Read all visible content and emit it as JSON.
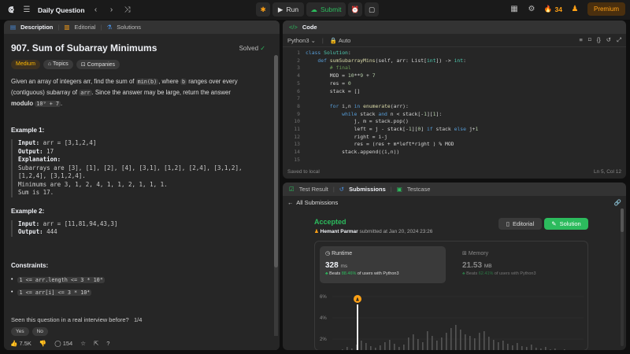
{
  "topbar": {
    "title": "Daily Question",
    "run_label": "Run",
    "submit_label": "Submit",
    "streak": "34",
    "premium_label": "Premium"
  },
  "left_tabs": {
    "description": "Description",
    "editorial": "Editorial",
    "solutions": "Solutions"
  },
  "problem": {
    "title": "907. Sum of Subarray Minimums",
    "status": "Solved",
    "tags": [
      "Medium",
      "Topics",
      "Companies"
    ],
    "desc_1": "Given an array of integers arr, find the sum of ",
    "desc_code_1": "min(b)",
    "desc_2": ", where ",
    "desc_code_2": "b",
    "desc_3": " ranges over every (contiguous) subarray of ",
    "desc_code_3": "arr",
    "desc_4": ". Since the answer may be large, return the answer ",
    "desc_bold": "modulo",
    "desc_code_4": "10⁹ + 7",
    "desc_5": ".",
    "example1_title": "Example 1:",
    "example1_input_label": "Input:",
    "example1_input": " arr = [3,1,2,4]",
    "example1_output_label": "Output:",
    "example1_output": " 17",
    "example1_expl_label": "Explanation:",
    "example1_expl": "Subarrays are [3], [1], [2], [4], [3,1], [1,2], [2,4], [3,1,2],\n[1,2,4], [3,1,2,4].\nMinimums are 3, 1, 2, 4, 1, 1, 2, 1, 1, 1.\nSum is 17.",
    "example2_title": "Example 2:",
    "example2_input_label": "Input:",
    "example2_input": " arr = [11,81,94,43,3]",
    "example2_output_label": "Output:",
    "example2_output": " 444",
    "constraints_title": "Constraints:",
    "constraint_1": "1 <= arr.length <= 3 * 10⁴",
    "constraint_2": "1 <= arr[i] <= 3 * 10⁴",
    "interview_q": "Seen this question in a real interview before?",
    "interview_count": "1/4",
    "yes": "Yes",
    "no": "No",
    "likes": "7.5K",
    "comments": "154"
  },
  "code_panel": {
    "tab": "Code",
    "language": "Python3",
    "mode": "Auto",
    "saved": "Saved to local",
    "cursor": "Ln 5, Col 12",
    "line_numbers": "1\n2\n3\n4\n5\n6\n7\n8\n9\n10\n11\n12\n13\n14\n15"
  },
  "submissions": {
    "tabs": [
      "Test Result",
      "Submissions",
      "Testcase"
    ],
    "all_label": "All Submissions",
    "result": "Accepted",
    "author": "Hemant Parmar",
    "submitted": " submitted at Jan 20, 2024 23:26",
    "editorial_btn": "Editorial",
    "solution_btn": "Solution",
    "runtime_label": "Runtime",
    "runtime_value": "328",
    "runtime_unit": "ms",
    "runtime_beats_pre": "Beats ",
    "runtime_beats": "88.46%",
    "runtime_beats_post": " of users with Python3",
    "memory_label": "Memory",
    "memory_value": "21.53",
    "memory_unit": "MB",
    "memory_beats_pre": "Beats ",
    "memory_beats": "62.41%",
    "memory_beats_post": " of users with Python3",
    "y_ticks": [
      "6%",
      "4%",
      "2%"
    ]
  },
  "colors": {
    "accent_green": "#2cbb5d",
    "accent_orange": "#ffa116",
    "medium_yellow": "#ffb800"
  }
}
